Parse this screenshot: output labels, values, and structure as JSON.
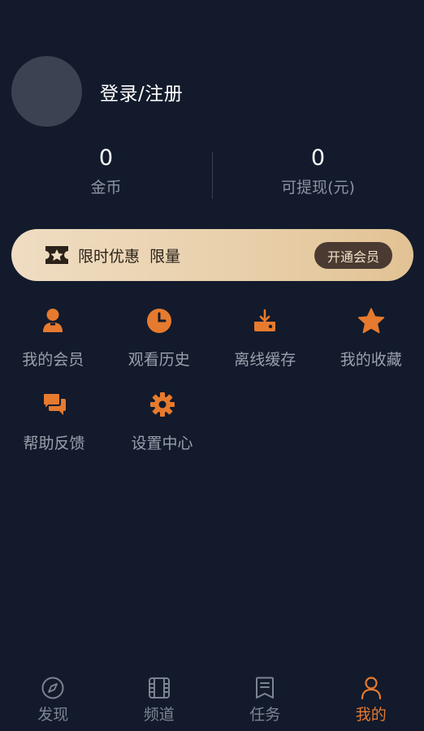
{
  "colors": {
    "background": "#121a2c",
    "accent": "#e67a2e",
    "muted_text": "#8c93a0",
    "vip_gold": "#e8cfa9",
    "vip_button": "#4a3a32"
  },
  "profile": {
    "login_label": "登录/注册"
  },
  "stats": {
    "coins": {
      "value": "0",
      "label": "金币"
    },
    "withdrawable": {
      "value": "0",
      "label": "可提现(元)"
    }
  },
  "vip": {
    "promo_text": "限时优惠  限量",
    "button_label": "开通会员",
    "icon": "ticket-star-icon"
  },
  "menu": {
    "items": [
      {
        "label": "我的会员",
        "icon": "user-icon"
      },
      {
        "label": "观看历史",
        "icon": "clock-icon"
      },
      {
        "label": "离线缓存",
        "icon": "download-icon"
      },
      {
        "label": "我的收藏",
        "icon": "star-icon"
      },
      {
        "label": "帮助反馈",
        "icon": "chat-icon"
      },
      {
        "label": "设置中心",
        "icon": "gear-icon"
      }
    ]
  },
  "nav": {
    "items": [
      {
        "label": "发现",
        "icon": "compass-icon",
        "active": false
      },
      {
        "label": "频道",
        "icon": "film-icon",
        "active": false
      },
      {
        "label": "任务",
        "icon": "task-icon",
        "active": false
      },
      {
        "label": "我的",
        "icon": "person-icon",
        "active": true
      }
    ]
  }
}
